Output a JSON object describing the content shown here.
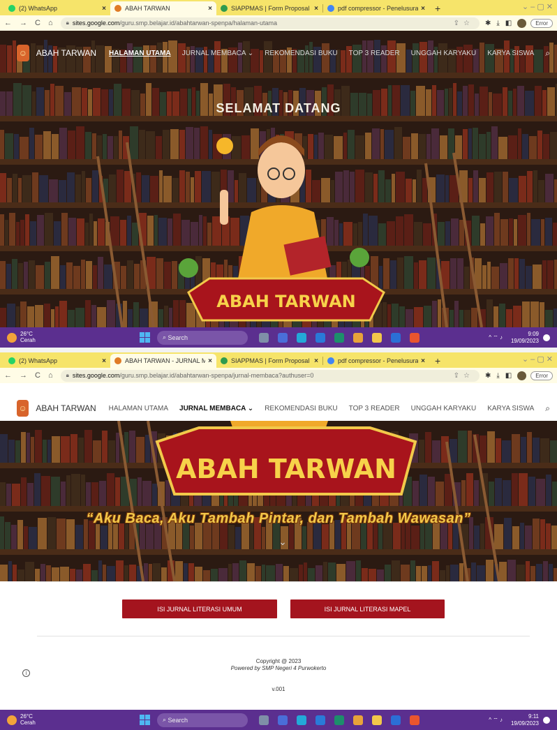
{
  "screenshot1": {
    "tabs": [
      {
        "title": "(2) WhatsApp",
        "color": "#25d366"
      },
      {
        "title": "ABAH TARWAN",
        "color": "#e07b26",
        "active": true
      },
      {
        "title": "SIAPPMAS | Form Proposal Inov",
        "color": "#2e9b4f"
      },
      {
        "title": "pdf compressor - Penelusuran G",
        "color": "#4285f4"
      }
    ],
    "url_host": "sites.google.com",
    "url_path": "/guru.smp.belajar.id/abahtarwan-spenpa/halaman-utama",
    "error_label": "Error",
    "brand": "ABAH TARWAN",
    "nav": [
      "HALAMAN UTAMA",
      "JURNAL MEMBACA ⌄",
      "REKOMENDASI BUKU",
      "TOP 3 READER",
      "UNGGAH KARYAKU",
      "KARYA SISWA"
    ],
    "hero_title": "SELAMAT DATANG",
    "banner_text": "ABAH TARWAN",
    "taskbar": {
      "temp": "26°C",
      "weather": "Cerah",
      "search": "Search",
      "time": "9:09",
      "date": "19/09/2023"
    }
  },
  "screenshot2": {
    "tabs": [
      {
        "title": "(2) WhatsApp",
        "color": "#25d366"
      },
      {
        "title": "ABAH TARWAN - JURNAL MEMB",
        "color": "#e07b26",
        "active": true
      },
      {
        "title": "SIAPPMAS | Form Proposal Inov",
        "color": "#2e9b4f"
      },
      {
        "title": "pdf compressor - Penelusuran G",
        "color": "#4285f4"
      }
    ],
    "url_host": "sites.google.com",
    "url_path": "/guru.smp.belajar.id/abahtarwan-spenpa/jurnal-membaca?authuser=0",
    "error_label": "Error",
    "brand": "ABAH TARWAN",
    "nav": [
      "HALAMAN UTAMA",
      "JURNAL MEMBACA ⌄",
      "REKOMENDASI BUKU",
      "TOP 3 READER",
      "UNGGAH KARYAKU",
      "KARYA SISWA"
    ],
    "banner_text": "ABAH TARWAN",
    "tagline": "“Aku Baca, Aku Tambah Pintar, dan Tambah Wawasan”",
    "buttons": [
      "ISI JURNAL LITERASI UMUM",
      "ISI JURNAL LITERASI MAPEL"
    ],
    "footer": {
      "copyright": "Copyright @ 2023",
      "powered": "Powered by SMP Negeri 4 Purwokerto",
      "version": "v.001"
    },
    "taskbar": {
      "temp": "26°C",
      "weather": "Cerah",
      "search": "Search",
      "time": "9:11",
      "date": "19/09/2023"
    }
  },
  "colors": {
    "tabstrip": "#f6e46a",
    "taskbar": "#5b2f8f",
    "button": "#a4141e",
    "banner": "#a8141c"
  },
  "icons": [
    "back-icon",
    "forward-icon",
    "reload-icon",
    "home-icon",
    "lock-icon",
    "share-icon",
    "bookmark-star-icon",
    "extensions-icon",
    "download-icon",
    "sidebar-icon",
    "search-icon",
    "windows-icon",
    "info-icon"
  ]
}
